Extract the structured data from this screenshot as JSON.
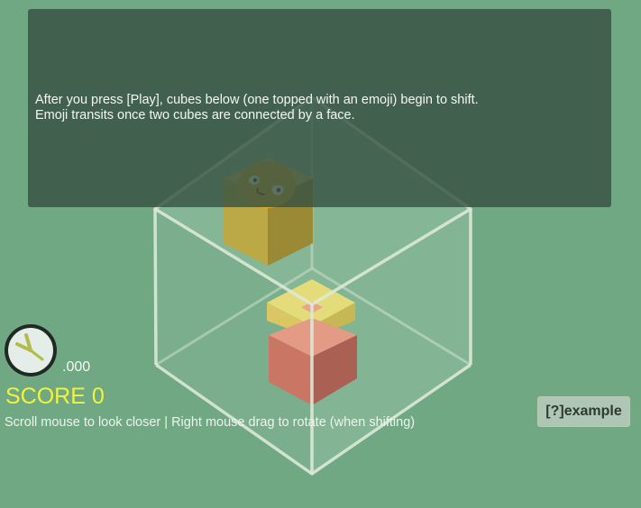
{
  "instructions": {
    "text": "After you press [Play], cubes below (one topped with an emoji) begin to shift. Emoji transits once two cubes are connected by a face."
  },
  "timer": {
    "value": ".000"
  },
  "score": {
    "label": "SCORE 0"
  },
  "hint": {
    "text": "Scroll mouse to look closer | Right mouse drag to rotate (when shifting)"
  },
  "example_button": {
    "label": "[?]example"
  },
  "colors": {
    "background": "#6fa883",
    "panel": "#375242",
    "score_text": "#f3f33c",
    "emoji_face": "#e0ad2e",
    "yellow_cube": "#d8cf6a",
    "pink_cube": "#e39b86"
  },
  "icons": {
    "clock": "clock-icon",
    "emoji": "smiley-emoji-icon"
  }
}
